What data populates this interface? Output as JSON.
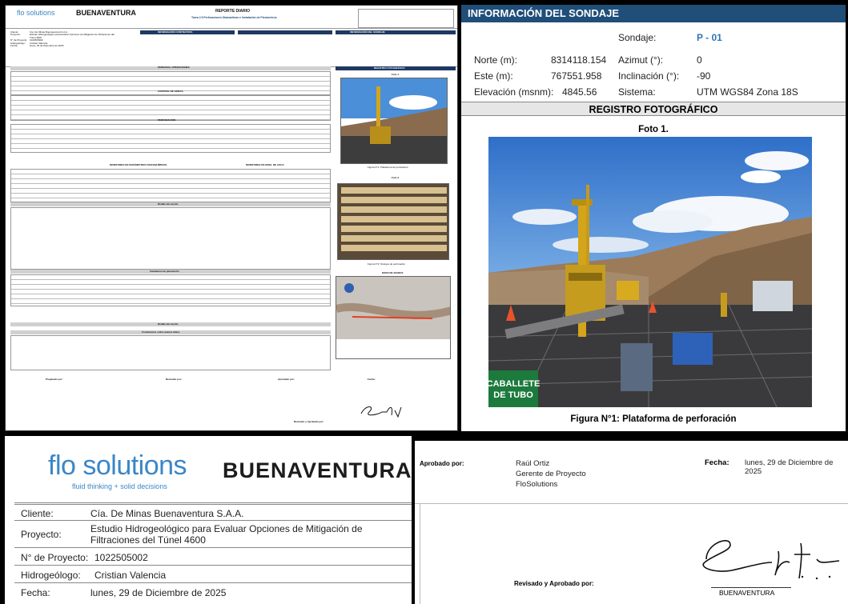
{
  "report": {
    "title": "REPORTE DIARIO",
    "subtitle": "Tarea 2.5 Perforaciones Diamantinas e Instalación de Piezómetros",
    "sections": {
      "info_contratista": "INFORMACIÓN CONTRATISTA",
      "info_sondaje": "INFORMACIÓN DEL SONDAJE",
      "personal": "PERSONAL OPERACIONES",
      "control": "CONTROL DE HORAS",
      "perforacion": "PERFORACIÓN",
      "monitoreo": "MONITOREO DE PARÁMETROS FISICOQUÍMICOS",
      "monitoreo_agua": "MONITOREO DE NIVEL DE AGUA",
      "detalle": "Detalle del evento",
      "instalacion": "Instalación de piezómetro",
      "comentarios": "Comentarios sobre avance diario",
      "registro": "REGISTRO FOTOGRÁFICO",
      "foto1": "Foto 1",
      "foto2": "Foto 2",
      "mapa": "MAPA DE AVANCE",
      "fig1": "Figura N°1: Plataforma de perforación",
      "fig2": "Figura N°2: Testigos de perforación",
      "preparado": "Preparado por:",
      "revisado": "Revisado por:",
      "aprobado": "Aprobado por:",
      "fecha": "Fecha:",
      "revisado_aprobado": "Revisado y Aprobado por:"
    }
  },
  "sondaje": {
    "title": "INFORMACIÓN DEL SONDAJE",
    "sondaje_label": "Sondaje:",
    "sondaje_value": "P - 01",
    "norte_label": "Norte (m):",
    "norte_value": "8314118.154",
    "azimut_label": "Azimut (°):",
    "azimut_value": "0",
    "este_label": "Este (m):",
    "este_value": "767551.958",
    "inclinacion_label": "Inclinación (°):",
    "inclinacion_value": "-90",
    "elevacion_label": "Elevación (msnm):",
    "elevacion_value": "4845.56",
    "sistema_label": "Sistema:",
    "sistema_value": "UTM WGS84 Zona 18S",
    "registro": "REGISTRO FOTOGRÁFICO",
    "foto_label": "Foto 1.",
    "figura": "Figura N°1: Plataforma de perforación",
    "sign_text": "CABALLETE DE TUBO"
  },
  "cliente": {
    "logo_flo": "flo solutions",
    "logo_tag": "fluid thinking + solid decisions",
    "logo_bvn": "BUENAVENTURA",
    "cliente_label": "Cliente:",
    "cliente_value": "Cía. De Minas Buenaventura S.A.A.",
    "proyecto_label": "Proyecto:",
    "proyecto_value": "Estudio Hidrogeológico para Evaluar Opciones de Mitigación de Filtraciones del Túnel 4600",
    "nproyecto_label": "N° de Proyecto:",
    "nproyecto_value": "1022505002",
    "hidro_label": "Hidrogeólogo:",
    "hidro_value": "Cristian Valencia",
    "fecha_label": "Fecha:",
    "fecha_value": "lunes, 29 de Diciembre de 2025"
  },
  "aprobacion": {
    "aprobado_label": "Aprobado por:",
    "nombre": "Raúl Ortiz",
    "cargo": "Gerente de Proyecto",
    "empresa": "FloSolutions",
    "fecha_label": "Fecha:",
    "fecha_value": "lunes, 29 de Diciembre de 2025",
    "revisado_label": "Revisado y Aprobado por:",
    "firma_empresa": "BUENAVENTURA"
  },
  "colors": {
    "header_blue": "#1f4e79",
    "accent_blue": "#2e75b6",
    "flo_blue": "#3a87c8",
    "bvn_gold": "#c9a227",
    "bvn_dark": "#1c1c1c"
  }
}
